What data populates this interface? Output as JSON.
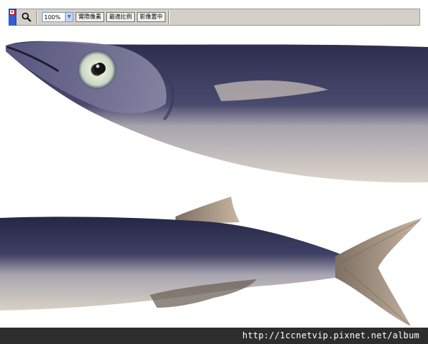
{
  "toolbar": {
    "zoom_value": "100%",
    "buttons": [
      "實際像素",
      "最適比例",
      "影像置中"
    ],
    "close_glyph": "✕",
    "icons": {
      "close": "close-icon",
      "zoom": "magnifier-icon",
      "dropdown": "chevron-down-icon"
    }
  },
  "footer": {
    "url": "http://1ccnetvip.pixnet.net/album"
  },
  "colors": {
    "grip": "#2f5fd0",
    "toolbar_bg": "#d4d0c8",
    "footer_bg": "#2d2d2d",
    "fish_back": "#2e2f52",
    "fish_belly": "#d8d3cc"
  }
}
